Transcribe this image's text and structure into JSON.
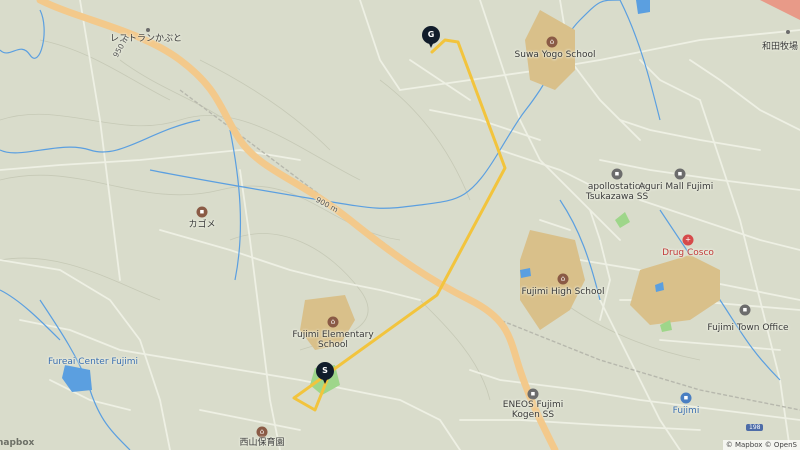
{
  "map": {
    "labels": {
      "restaurant": "レストランかぶと",
      "kagome": "カゴメ",
      "suwa_yogo": "Suwa Yogo School",
      "apollostation": "apollostation\nTsukazawa SS",
      "aguri_mall": "Aguri Mall Fujimi",
      "drug_cosco": "Drug Cosco",
      "fujimi_high": "Fujimi High School",
      "fujimi_elementary": "Fujimi Elementary\nSchool",
      "fujimi_town_office": "Fujimi Town Office",
      "fureai_center": "Fureai Center Fujimi",
      "eneos": "ENEOS Fujimi\nKogen SS",
      "fujimi_station": "Fujimi",
      "nishiyama": "西山保育園",
      "wadabokujo": "和田牧場",
      "contour_900": "900 m",
      "contour_950": "950 m",
      "route_number": "198"
    },
    "markers": {
      "start": "S",
      "goal": "G"
    },
    "logo": "mapbox",
    "attribution": "© Mapbox © OpenS"
  },
  "colors": {
    "land": "#d9dccb",
    "route": "#f2c43d",
    "highway": "#f3c98b",
    "water": "#5b9fe0",
    "school_area": "#d9c08a",
    "park": "#9ed68a",
    "marker": "#111c2b"
  }
}
